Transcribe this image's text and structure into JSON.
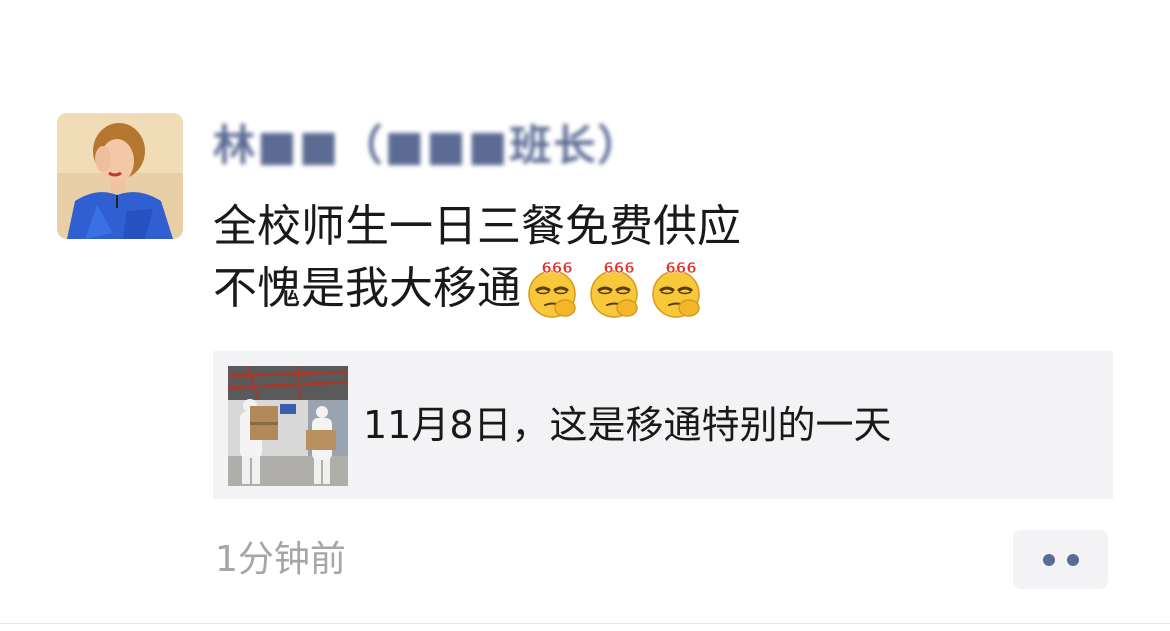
{
  "post": {
    "author_name": "林■■（■■■班长）",
    "text_line_1": "全校师生一日三餐免费供应",
    "text_line_2": "不愧是我大移通",
    "emoji": [
      "666-emoji",
      "666-emoji",
      "666-emoji"
    ],
    "emoji_label": "666",
    "link": {
      "title": "11月8日，这是移通特别的一天"
    },
    "timestamp": "1分钟前"
  },
  "colors": {
    "author_link": "#5b6b93",
    "body_text": "#191919",
    "timestamp": "#a6a6a6",
    "card_bg": "#f3f3f5"
  }
}
